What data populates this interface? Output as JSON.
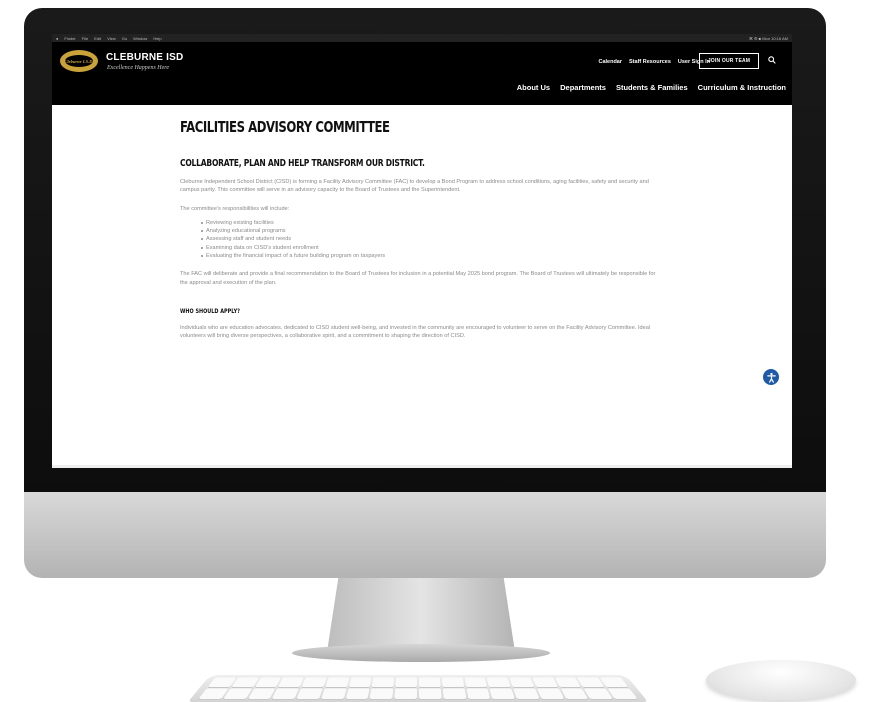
{
  "menubar": {
    "items": [
      "Finder",
      "File",
      "Edit",
      "View",
      "Go",
      "Window",
      "Help"
    ],
    "status": "⌘ ⚙ ■ Mon 10:16 AM"
  },
  "header": {
    "logo_text": "Cleburne I.S.D.",
    "brand_name": "CLEBURNE ISD",
    "tagline": "Excellence Happens Here",
    "util_links": [
      "Calendar",
      "Staff Resources",
      "User Sign In"
    ],
    "join_label": "JOIN OUR TEAM",
    "main_nav": [
      "About Us",
      "Departments",
      "Students & Families",
      "Curriculum & Instruction"
    ]
  },
  "content": {
    "title": "FACILITIES ADVISORY COMMITTEE",
    "heading": "COLLABORATE, PLAN AND HELP TRANSFORM OUR DISTRICT.",
    "intro": "Cleburne Independent School District (CISD) is forming a Facility Advisory Committee (FAC) to develop a Bond Program to address school conditions, aging facilities, safety and security and campus parity. This committee will serve in an advisory capacity to the Board of Trustees and the Superintendent.",
    "responsibilities_intro": "The committee's responsibilities will include:",
    "responsibilities": [
      "Reviewing existing facilities",
      "Analyzing educational programs",
      "Assessing staff and student needs",
      "Examining data on CISD's student enrollment",
      "Evaluating the financial impact of a future building program on taxpayers"
    ],
    "deliberate": "The FAC will deliberate and provide a final recommendation to the Board of Trustees for inclusion in a potential May 2025 bond program. The Board of Trustees will ultimately be responsible for the approval and execution of the plan.",
    "who_heading": "WHO SHOULD APPLY?",
    "who_text": "Individuals who are education advocates, dedicated to CISD student well-being, and invested in the community are encouraged to volunteer to serve on the Facility Advisory Committee. Ideal volunteers will bring diverse perspectives, a collaborative spirit, and a commitment to shaping the direction of CISD."
  },
  "colors": {
    "header_bg": "#000000",
    "brand_gold": "#c9a23a",
    "body_text": "#8a8a8a",
    "accessibility_blue": "#1e5aa8"
  },
  "icons": {
    "search": "search-icon",
    "accessibility": "accessibility-icon"
  }
}
